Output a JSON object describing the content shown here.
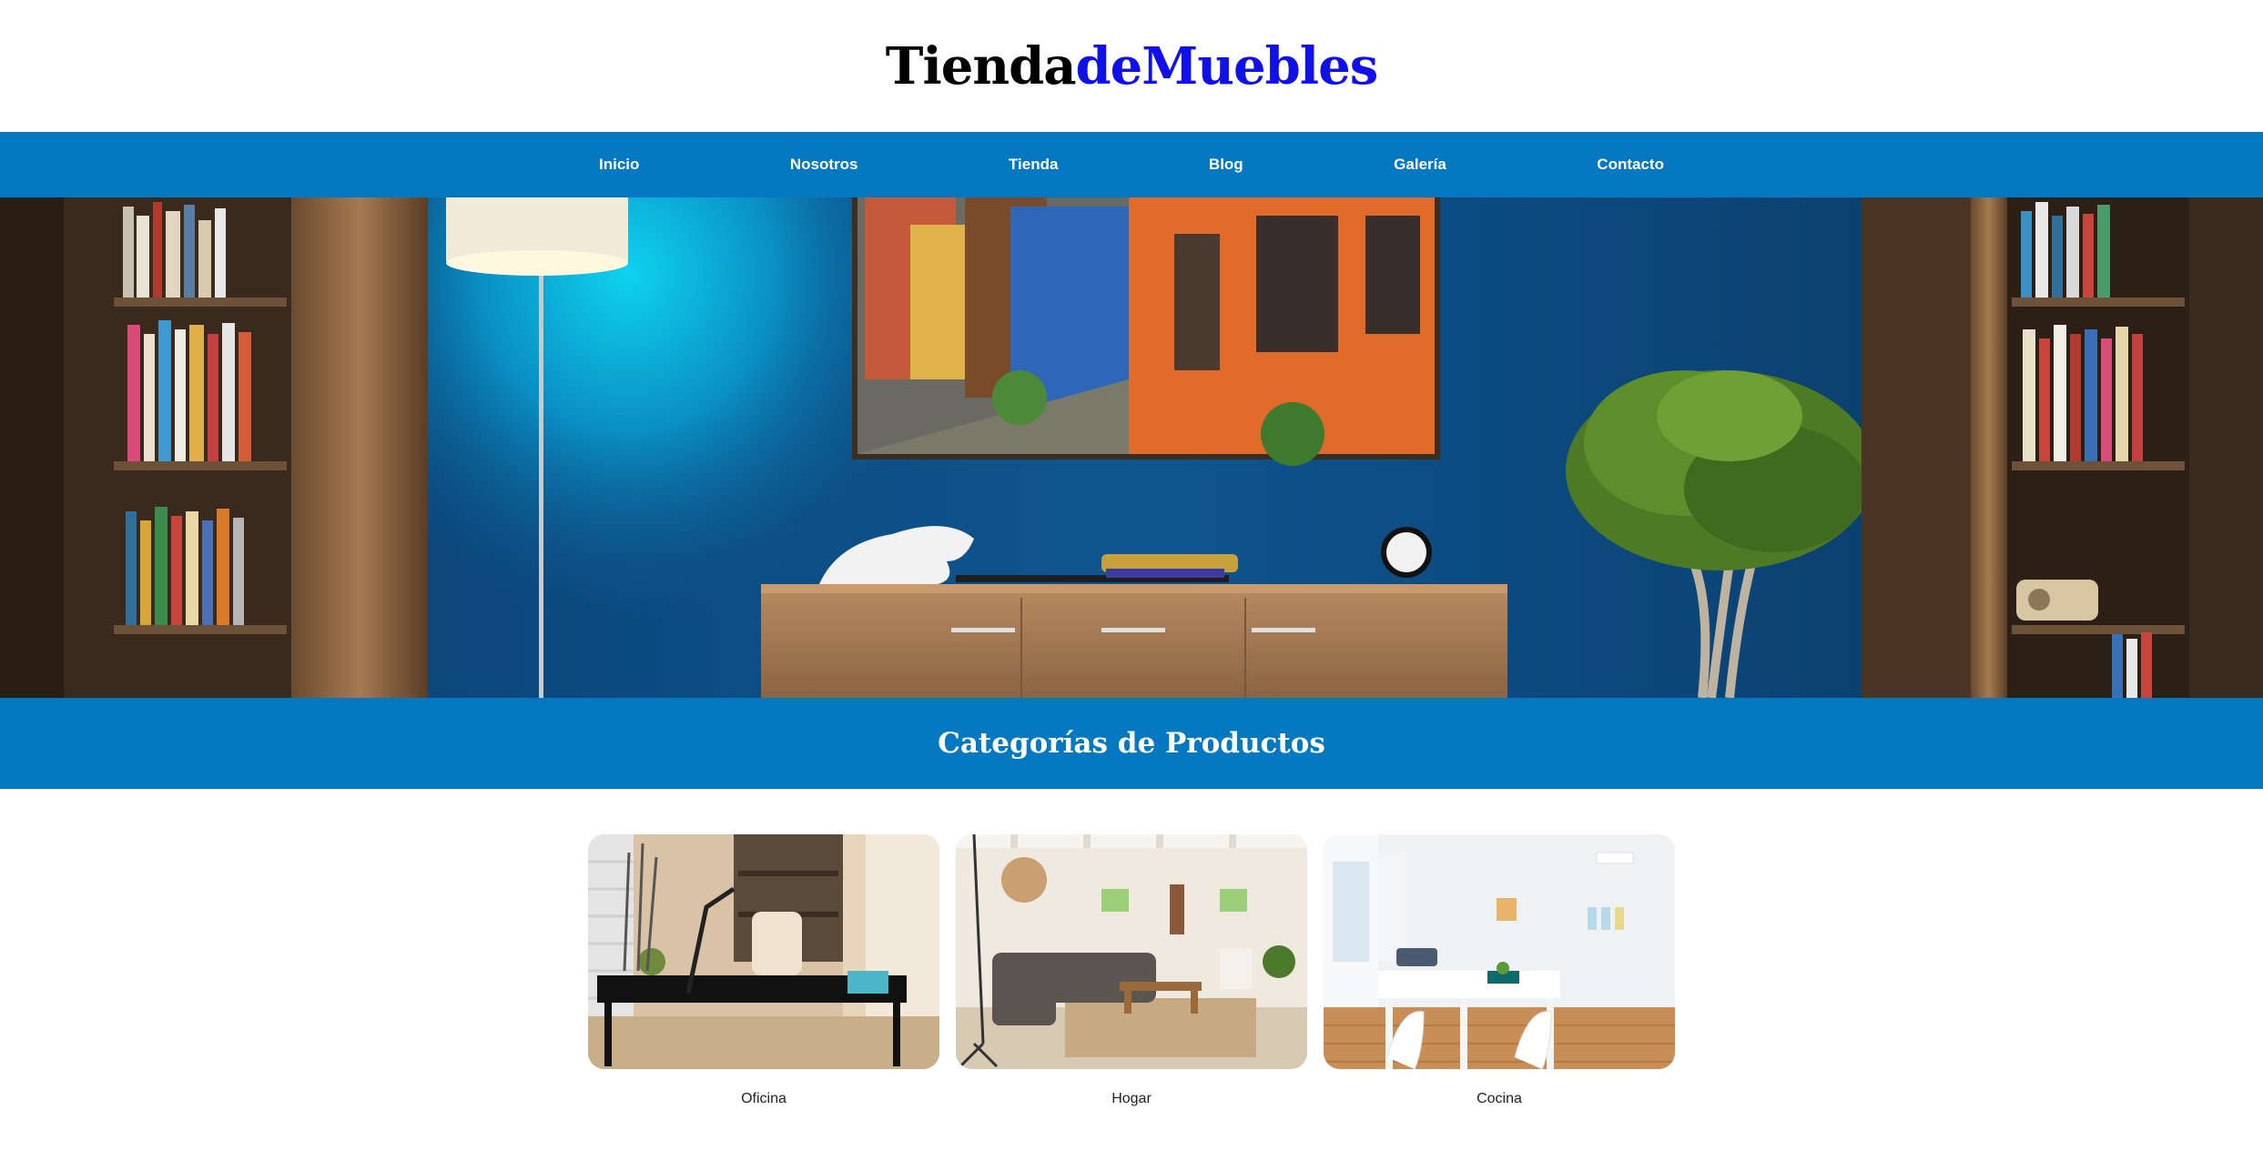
{
  "header": {
    "logo_part1": "Tienda",
    "logo_part2": "deMuebles"
  },
  "nav": {
    "items": [
      {
        "label": "Inicio"
      },
      {
        "label": "Nosotros"
      },
      {
        "label": "Tienda"
      },
      {
        "label": "Blog"
      },
      {
        "label": "Galería"
      },
      {
        "label": "Contacto"
      }
    ]
  },
  "hero": {
    "image_name": "living-room-hero-image"
  },
  "section": {
    "title": "Categorías de Productos"
  },
  "categories": [
    {
      "label": "Oficina",
      "icon": "office-photo"
    },
    {
      "label": "Hogar",
      "icon": "living-room-photo"
    },
    {
      "label": "Cocina",
      "icon": "dining-room-photo"
    }
  ],
  "colors": {
    "brand_blue": "#0478c1",
    "logo_accent": "#1010e8",
    "wall_blue": "#0c4f86"
  }
}
